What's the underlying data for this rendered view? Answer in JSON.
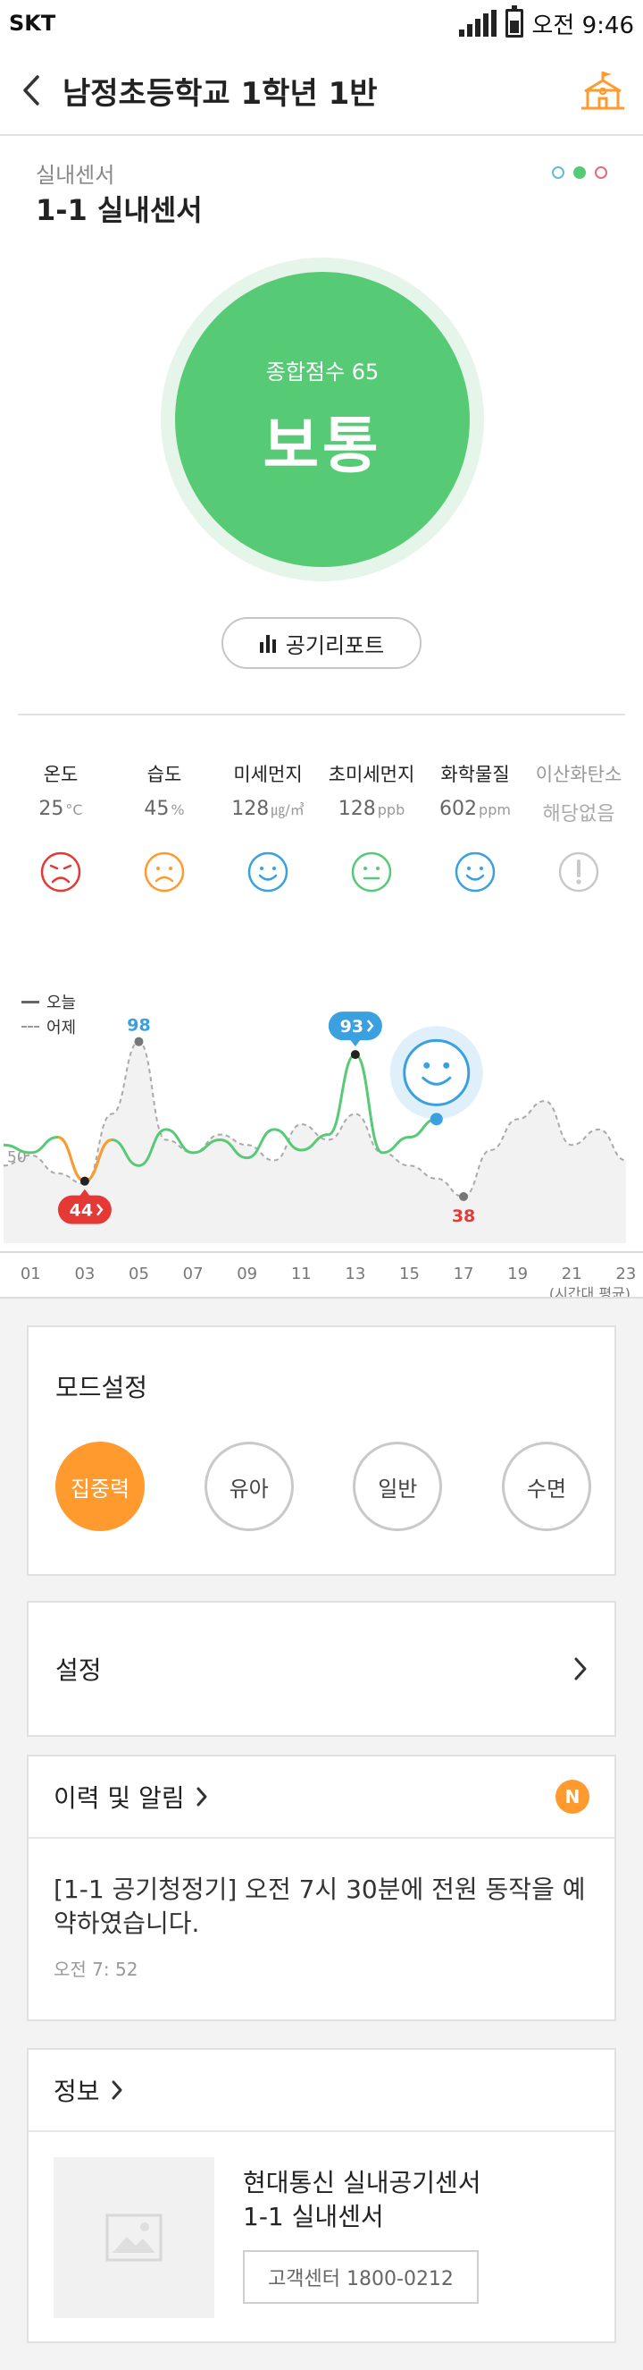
{
  "status_bar": {
    "carrier": "SKT",
    "time": "오전 9:46"
  },
  "header": {
    "title": "남정초등학교 1학년 1반"
  },
  "sensor": {
    "category": "실내센서",
    "name": "1-1 실내센서",
    "page_dots": [
      "#64b8e8",
      "#57ca76",
      "#e86a7a"
    ]
  },
  "score": {
    "label": "종합점수 65",
    "grade": "보통",
    "color": "#57ca76"
  },
  "report_button": {
    "label": "공기리포트",
    "icon": "bar-chart-icon"
  },
  "metrics": [
    {
      "name": "온도",
      "value": "25",
      "unit": "°C",
      "face": "sad",
      "color": "#e53935"
    },
    {
      "name": "습도",
      "value": "45",
      "unit": "%",
      "face": "sad",
      "color": "#ff9a2e"
    },
    {
      "name": "미세먼지",
      "value": "128",
      "unit": "㎍/㎥",
      "face": "smile",
      "color": "#3aa0e0"
    },
    {
      "name": "초미세먼지",
      "value": "128",
      "unit": "ppb",
      "face": "neutral",
      "color": "#57ca76"
    },
    {
      "name": "화학물질",
      "value": "602",
      "unit": "ppm",
      "face": "smile",
      "color": "#3aa0e0"
    },
    {
      "name": "이산화탄소",
      "value": "해당없음",
      "unit": "",
      "face": "alert",
      "color": "#c9c9c9"
    }
  ],
  "chart_data": {
    "type": "line",
    "legend": [
      "오늘",
      "어제"
    ],
    "x_ticks": [
      "01",
      "03",
      "05",
      "07",
      "09",
      "11",
      "13",
      "15",
      "17",
      "19",
      "21",
      "23"
    ],
    "x_note": "(시간대 평균)",
    "y_ref_label": "50",
    "series": [
      {
        "name": "오늘",
        "color": "#57ca76",
        "x": [
          0,
          1,
          2,
          3,
          4,
          5,
          6,
          7,
          8,
          9,
          10,
          11,
          12,
          13,
          14,
          15,
          16
        ],
        "y": [
          58,
          55,
          61,
          44,
          60,
          50,
          64,
          55,
          60,
          53,
          64,
          56,
          62,
          93,
          55,
          61,
          68
        ]
      },
      {
        "name": "어제",
        "color": "#aaaaaa",
        "dashed": true,
        "x": [
          0,
          1,
          2,
          3,
          4,
          5,
          6,
          7,
          8,
          9,
          10,
          11,
          12,
          13,
          14,
          15,
          16,
          17,
          18,
          19,
          20,
          21,
          22,
          23
        ],
        "y": [
          50,
          54,
          47,
          43,
          70,
          98,
          60,
          55,
          62,
          58,
          52,
          66,
          60,
          70,
          55,
          50,
          45,
          38,
          56,
          68,
          75,
          58,
          64,
          52
        ]
      }
    ],
    "markers": [
      {
        "label": "98",
        "color": "#3aa0e0",
        "style": "text"
      },
      {
        "label": "93",
        "color": "#3aa0e0",
        "style": "pill"
      },
      {
        "label": "44",
        "color": "#e53935",
        "style": "pill"
      },
      {
        "label": "38",
        "color": "#e53935",
        "style": "text"
      }
    ]
  },
  "mode_settings": {
    "title": "모드설정",
    "modes": [
      "집중력",
      "유아",
      "일반",
      "수면"
    ],
    "active": "집중력"
  },
  "settings": {
    "label": "설정"
  },
  "history": {
    "title": "이력 및 알림",
    "badge": "N",
    "message": "[1-1 공기청정기] 오전 7시 30분에 전원 동작을 예약하였습니다.",
    "time": "오전 7: 52"
  },
  "info": {
    "title": "정보",
    "product_line1": "현대통신 실내공기센서",
    "product_line2": "1-1 실내센서",
    "cs_button": "고객센터 1800-0212"
  }
}
